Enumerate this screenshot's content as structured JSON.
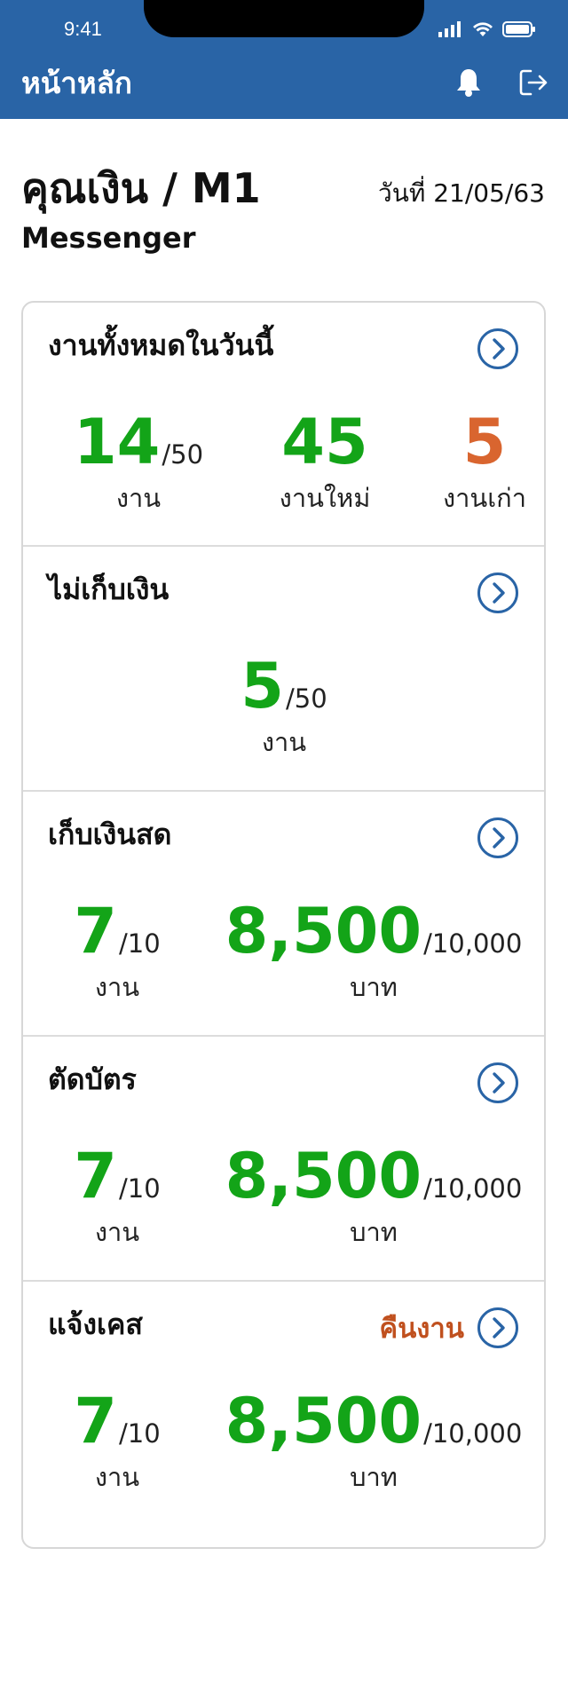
{
  "status": {
    "time": "9:41"
  },
  "header": {
    "title": "หน้าหลัก"
  },
  "user": {
    "name": "คุณเงิน / M1",
    "role": "Messenger",
    "date": "วันที่ 21/05/63"
  },
  "sections": [
    {
      "title": "งานทั้งหมดในวันนี้",
      "metrics": [
        {
          "value": "14",
          "total": "/50",
          "unit": "งาน"
        },
        {
          "value": "45",
          "total": "",
          "unit": "งานใหม่"
        },
        {
          "value": "5",
          "total": "",
          "unit": "งานเก่า"
        }
      ]
    },
    {
      "title": "ไม่เก็บเงิน",
      "metrics": [
        {
          "value": "5",
          "total": "/50",
          "unit": "งาน"
        }
      ]
    },
    {
      "title": "เก็บเงินสด",
      "metrics": [
        {
          "value": "7",
          "total": "/10",
          "unit": "งาน"
        },
        {
          "value": "8,500",
          "total": "/10,000",
          "unit": "บาท"
        }
      ]
    },
    {
      "title": "ตัดบัตร",
      "metrics": [
        {
          "value": "7",
          "total": "/10",
          "unit": "งาน"
        },
        {
          "value": "8,500",
          "total": "/10,000",
          "unit": "บาท"
        }
      ]
    },
    {
      "title": "แจ้งเคส",
      "return_label": "คืนงาน",
      "metrics": [
        {
          "value": "7",
          "total": "/10",
          "unit": "งาน"
        },
        {
          "value": "8,500",
          "total": "/10,000",
          "unit": "บาท"
        }
      ]
    }
  ],
  "colors": {
    "primary": "#2964a6",
    "green": "#13a418",
    "orange": "#d9652f",
    "return": "#c0501e"
  },
  "icons": {
    "bell": "bell-icon",
    "logout": "logout-icon",
    "arrow": "chevron-right-circle-icon"
  }
}
